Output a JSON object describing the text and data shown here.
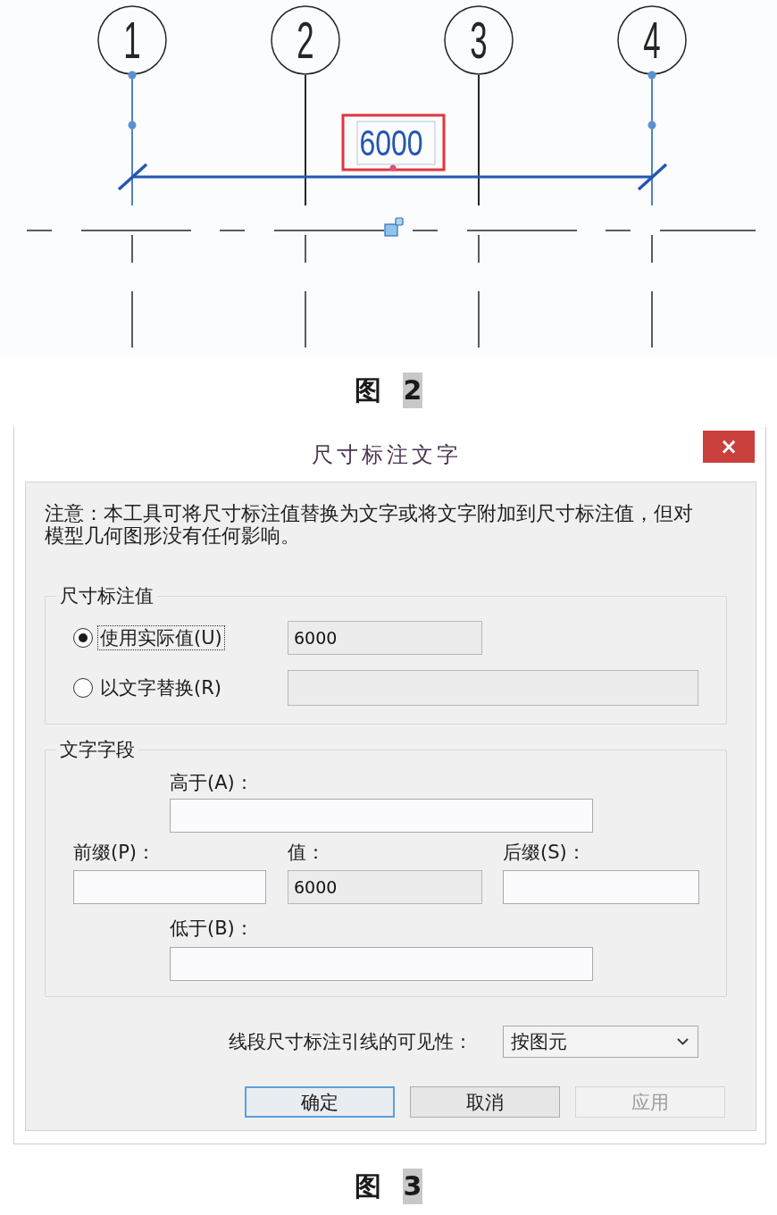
{
  "figure_2": {
    "grid_markers": [
      {
        "label": "1",
        "selected": true
      },
      {
        "label": "2",
        "selected": false
      },
      {
        "label": "3",
        "selected": false
      },
      {
        "label": "4",
        "selected": true
      }
    ],
    "dimension": {
      "value": "6000",
      "highlighted": true
    },
    "caption": {
      "label": "图",
      "number": "2",
      "highlighted": true
    }
  },
  "dialog": {
    "title": "尺寸标注文字",
    "close_label": "×",
    "note": "注意：本工具可将尺寸标注值替换为文字或将文字附加到尺寸标注值，但对模型几何图形没有任何影响。",
    "value_group": {
      "legend": "尺寸标注值",
      "options": [
        {
          "label": "使用实际值(U)",
          "selected": true,
          "focused": true,
          "field": {
            "value": "6000",
            "editable": false
          }
        },
        {
          "label": "以文字替换(R)",
          "selected": false,
          "focused": false,
          "field": {
            "editable": false
          }
        }
      ]
    },
    "text_group": {
      "legend": "文字字段",
      "above": {
        "label": "高于(A)：",
        "editable": true
      },
      "prefix": {
        "label": "前缀(P)：",
        "editable": true
      },
      "value": {
        "label": "值：",
        "value": "6000",
        "editable": false
      },
      "suffix": {
        "label": "后缀(S)：",
        "editable": true
      },
      "below": {
        "label": "低于(B)：",
        "editable": true
      }
    },
    "leader_visibility": {
      "label": "线段尺寸标注引线的可见性：",
      "value": "按图元"
    },
    "buttons": [
      {
        "label": "确定",
        "default": true,
        "disabled": false
      },
      {
        "label": "取消",
        "default": false,
        "disabled": false
      },
      {
        "label": "应用",
        "default": false,
        "disabled": true
      }
    ]
  },
  "figure_3": {
    "caption": {
      "label": "图",
      "number": "3",
      "highlighted": true
    }
  }
}
